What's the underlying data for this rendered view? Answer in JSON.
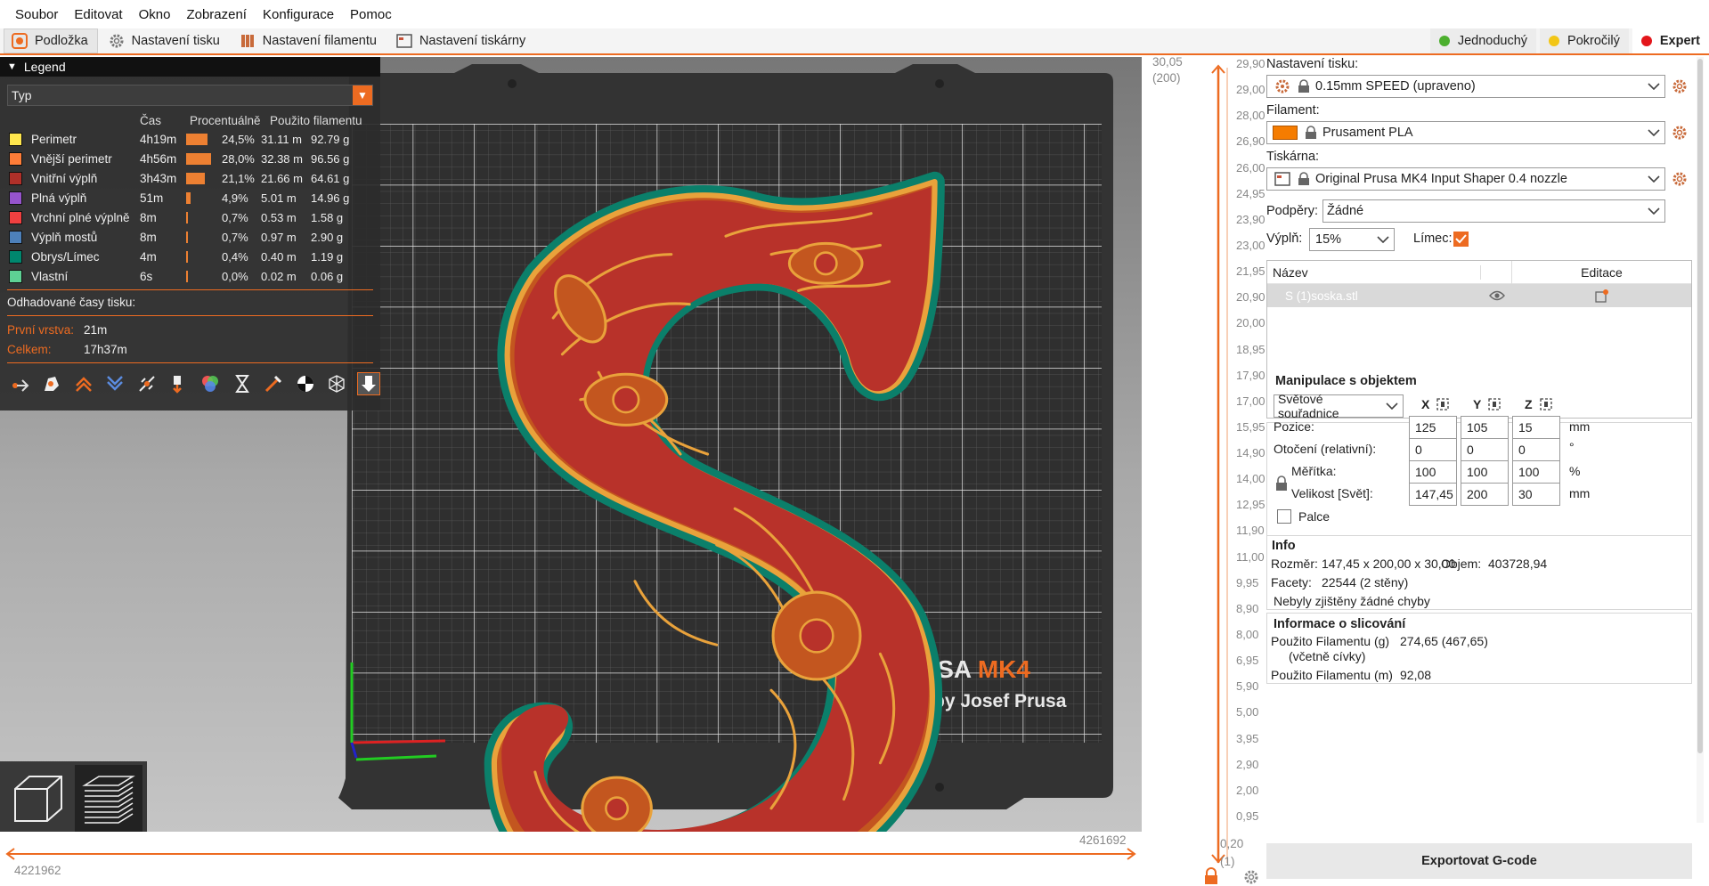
{
  "menu": [
    "Soubor",
    "Editovat",
    "Okno",
    "Zobrazení",
    "Konfigurace",
    "Pomoc"
  ],
  "tabs": [
    {
      "label": "Podložka",
      "icon": "plater-icon",
      "active": true
    },
    {
      "label": "Nastavení tisku",
      "icon": "print-settings-gear-icon",
      "active": false
    },
    {
      "label": "Nastavení filamentu",
      "icon": "filament-spool-icon",
      "active": false
    },
    {
      "label": "Nastavení tiskárny",
      "icon": "printer-icon",
      "active": false
    }
  ],
  "modes": [
    {
      "label": "Jednoduchý",
      "color": "#4caf2e"
    },
    {
      "label": "Pokročilý",
      "color": "#f2c616"
    },
    {
      "label": "Expert",
      "color": "#e3161b"
    }
  ],
  "legend": {
    "title": "Legend",
    "type_label": "Typ",
    "headers": {
      "time": "Čas",
      "percent": "Procentuálně",
      "filament": "Použito filamentu"
    },
    "rows": [
      {
        "name": "Perimetr",
        "color": "#ffe64d",
        "time": "4h19m",
        "percent": "24,5%",
        "bar": 0.245,
        "length": "31.11 m",
        "weight": "92.79 g"
      },
      {
        "name": "Vnější perimetr",
        "color": "#ff7d38",
        "time": "4h56m",
        "percent": "28,0%",
        "bar": 0.28,
        "length": "32.38 m",
        "weight": "96.56 g"
      },
      {
        "name": "Vnitřní výplň",
        "color": "#b03029",
        "time": "3h43m",
        "percent": "21,1%",
        "bar": 0.211,
        "length": "21.66 m",
        "weight": "64.61 g"
      },
      {
        "name": "Plná výplň",
        "color": "#9654cc",
        "time": "51m",
        "percent": "4,9%",
        "bar": 0.049,
        "length": "5.01 m",
        "weight": "14.96 g"
      },
      {
        "name": "Vrchní plné výplně",
        "color": "#f04040",
        "time": "8m",
        "percent": "0,7%",
        "bar": 0.007,
        "length": "0.53 m",
        "weight": "1.58 g"
      },
      {
        "name": "Výplň mostů",
        "color": "#4d80ba",
        "time": "8m",
        "percent": "0,7%",
        "bar": 0.007,
        "length": "0.97 m",
        "weight": "2.90 g"
      },
      {
        "name": "Obrys/Límec",
        "color": "#00876e",
        "time": "4m",
        "percent": "0,4%",
        "bar": 0.004,
        "length": "0.40 m",
        "weight": "1.19 g"
      },
      {
        "name": "Vlastní",
        "color": "#5ed194",
        "time": "6s",
        "percent": "0,0%",
        "bar": 0.0,
        "length": "0.02 m",
        "weight": "0.06 g"
      }
    ],
    "estimated_label": "Odhadované časy tisku:",
    "first_layer_label": "První vrstva:",
    "first_layer_value": "21m",
    "total_label": "Celkem:",
    "total_value": "17h37m"
  },
  "bed_logo": {
    "line1_a": "USA ",
    "line1_b": "MK4",
    "line2": "by Josef Prusa"
  },
  "hslider": {
    "right_value": "4261692",
    "left_value": "4221962"
  },
  "vslider": {
    "top_value": "30,05",
    "top_layer": "(200)",
    "bottom_value": "0,20",
    "bottom_layer": "(1)",
    "ticks": [
      "29,90",
      "29,00",
      "28,00",
      "26,90",
      "26,00",
      "24,95",
      "23,90",
      "23,00",
      "21,95",
      "20,90",
      "20,00",
      "18,95",
      "17,90",
      "17,00",
      "15,95",
      "14,90",
      "14,00",
      "12,95",
      "11,90",
      "11,00",
      "9,95",
      "8,90",
      "8,00",
      "6,95",
      "5,90",
      "5,00",
      "3,95",
      "2,90",
      "2,00",
      "0,95"
    ]
  },
  "panel": {
    "print_settings_label": "Nastavení tisku:",
    "print_settings_value": "0.15mm SPEED (upraveno)",
    "filament_label": "Filament:",
    "filament_value": "Prusament PLA",
    "filament_color": "#f57c00",
    "printer_label": "Tiskárna:",
    "printer_value": "Original Prusa MK4 Input Shaper 0.4 nozzle",
    "supports_label": "Podpěry:",
    "supports_value": "Žádné",
    "infill_label": "Výplň:",
    "infill_value": "15%",
    "brim_label": "Límec:",
    "objects_headers": {
      "name": "Název",
      "edit": "Editace"
    },
    "object_name": "S (1)soska.stl",
    "manip_title": "Manipulace s objektem",
    "coord_mode": "Světové souřadnice",
    "axes": [
      "X",
      "Y",
      "Z"
    ],
    "position_label": "Pozice:",
    "position": [
      "125",
      "105",
      "15"
    ],
    "position_unit": "mm",
    "rotation_label": "Otočení (relativní):",
    "rotation": [
      "0",
      "0",
      "0"
    ],
    "rotation_unit": "°",
    "scale_label": "Měřítka:",
    "scale": [
      "100",
      "100",
      "100"
    ],
    "scale_unit": "%",
    "size_label": "Velikost [Svět]:",
    "size": [
      "147,45",
      "200",
      "30"
    ],
    "size_unit": "mm",
    "inches_label": "Palce",
    "info_title": "Info",
    "size_info_label": "Rozměr:",
    "size_info_value": "147,45 x 200,00 x 30,00",
    "volume_label": "Objem:",
    "volume_value": "403728,94",
    "facets_label": "Facety:",
    "facets_value": "22544 (2 stěny)",
    "errors_text": "Nebyly zjištěny žádné chyby",
    "slice_title": "Informace o slicování",
    "used_g_label": "Použito Filamentu (g)",
    "used_g_sub": "(včetně cívky)",
    "used_g_value": "274,65 (467,65)",
    "used_m_label": "Použito Filamentu (m)",
    "used_m_value": "92,08",
    "export_label": "Exportovat G-code"
  }
}
